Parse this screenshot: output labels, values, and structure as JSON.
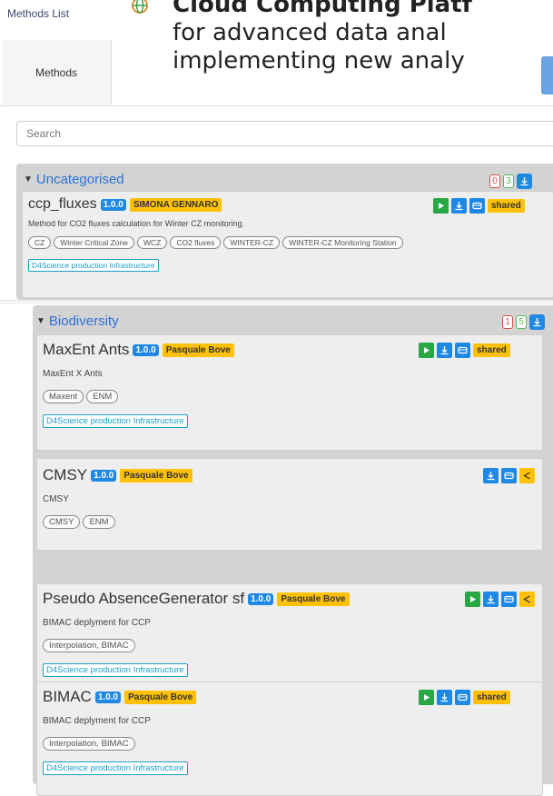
{
  "header": {
    "title": "Methods List",
    "headline": "Cloud Computing Platf",
    "line2": "for advanced data anal",
    "line3": "implementing new analy",
    "tab": "Methods",
    "search_placeholder": "Search"
  },
  "categories": [
    {
      "name": "Uncategorised",
      "counts": {
        "red": "0",
        "green": "3"
      },
      "methods": [
        {
          "name": "ccp_fluxes",
          "version": "1.0.0",
          "author": "SIMONA GENNARO",
          "description": "Method for CO2 fluxes calculation for Winter CZ monitoring.",
          "tags": [
            "CZ",
            "Winter Critical Zone",
            "WCZ",
            "CO2 fluxes",
            "WINTER-CZ",
            "WINTER-CZ Monitoring Station"
          ],
          "infra": "D4Science production Infrastructure",
          "share_label": "shared"
        }
      ]
    },
    {
      "name": "Biodiversity",
      "counts": {
        "red": "1",
        "green": "5"
      },
      "methods": [
        {
          "name": "MaxEnt Ants",
          "version": "1.0.0",
          "author": "Pasquale Bove",
          "description": "MaxEnt X Ants",
          "tags": [
            "Maxent",
            "ENM"
          ],
          "infra": "D4Science production Infrastructure",
          "share_label": "shared"
        },
        {
          "name": "CMSY",
          "version": "1.0.0",
          "author": "Pasquale Bove",
          "description": "CMSY",
          "tags": [
            "CMSY",
            "ENM"
          ]
        },
        {
          "name": "Pseudo AbsenceGenerator sf",
          "version": "1.0.0",
          "author": "Pasquale Bove",
          "description": "BIMAC deplyment for CCP",
          "tags": [
            "Interpolation, BIMAC"
          ],
          "infra": "D4Science production Infrastructure"
        },
        {
          "name": "BIMAC",
          "version": "1.0.0",
          "author": "Pasquale Bove",
          "description": "BIMAC deplyment for CCP",
          "tags": [
            "Interpolation, BIMAC"
          ],
          "infra": "D4Science production Infrastructure",
          "share_label": "shared"
        }
      ]
    }
  ],
  "colors": {
    "accent": "#1e88e5",
    "run": "#28a745",
    "badge": "#ffc107",
    "infra": "#1a9fc7"
  }
}
